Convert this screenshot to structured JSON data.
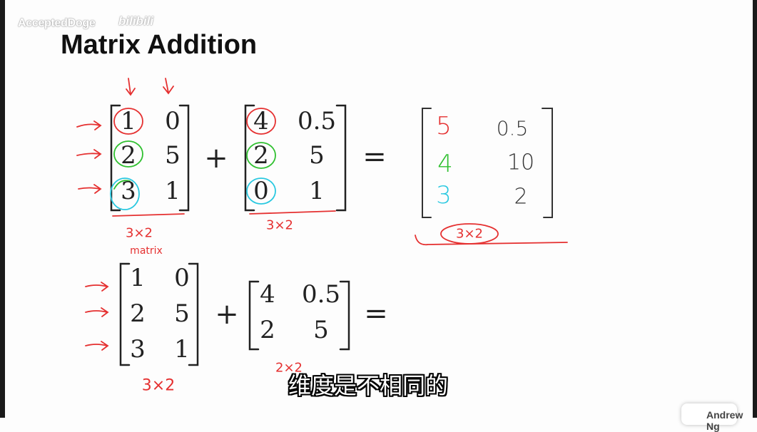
{
  "watermark": {
    "channel": "AcceptedDoge",
    "site": "bilibili"
  },
  "slide": {
    "title": "Matrix Addition",
    "example1": {
      "A": [
        [
          "1",
          "0"
        ],
        [
          "2",
          "5"
        ],
        [
          "3",
          "1"
        ]
      ],
      "B": [
        [
          "4",
          "0.5"
        ],
        [
          "2",
          "5"
        ],
        [
          "0",
          "1"
        ]
      ],
      "plus": "+",
      "equals": "=",
      "result": [
        [
          "5",
          "0.5"
        ],
        [
          "4",
          "10"
        ],
        [
          "3",
          "2"
        ]
      ],
      "dimA": "3×2",
      "dimA_note": "matrix",
      "dimB": "3×2",
      "dimResult": "3×2"
    },
    "example2": {
      "C": [
        [
          "1",
          "0"
        ],
        [
          "2",
          "5"
        ],
        [
          "3",
          "1"
        ]
      ],
      "D": [
        [
          "4",
          "0.5"
        ],
        [
          "2",
          "5"
        ]
      ],
      "plus": "+",
      "equals": "=",
      "dimC": "3×2",
      "dimD": "2×2"
    },
    "author": "Andrew Ng"
  },
  "subtitle": "维度是不相同的",
  "colors": {
    "ink_red": "#e53030",
    "ink_green": "#2fc02f",
    "ink_cyan": "#28c8e0"
  }
}
